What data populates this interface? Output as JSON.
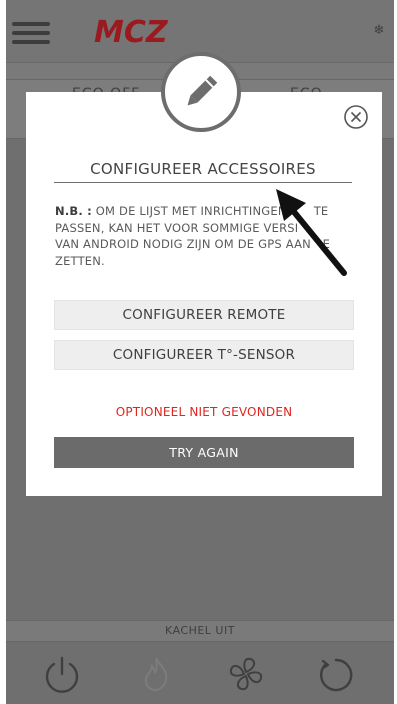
{
  "header": {
    "menu_icon": "hamburger-icon",
    "logo_text": "MCZ",
    "logo_color": "#c8161d",
    "right_icon": "snowflake-icon"
  },
  "modes": {
    "left": "ECO OFF",
    "right": "ECO"
  },
  "status": {
    "text": "KACHEL UIT"
  },
  "bottom_bar": {
    "icons": [
      "power-icon",
      "flame-icon",
      "fan-icon",
      "refresh-icon"
    ]
  },
  "modal": {
    "badge_icon": "pencil-icon",
    "close_icon": "close-circle-icon",
    "title": "CONFIGUREER ACCESSOIRES",
    "note_label": "N.B. :",
    "note_text": "OM DE LIJST MET INRICHTINGEN ... TE PASSEN, KAN HET VOOR SOMMIGE VERSI... VAN ANDROID NODIG ZIJN OM DE GPS AAN ... ZETTEN.",
    "note_line1": " OM DE LIJST MET INRICHTINGEN",
    "note_line1b": "TE",
    "note_line2": "PASSEN, KAN HET VOOR SOMMIGE VERSI",
    "note_line3": "VAN ANDROID NODIG ZIJN OM DE GPS AAN",
    "note_line3b": "E",
    "note_line4": "ZETTEN.",
    "buttons": {
      "remote": "CONFIGUREER REMOTE",
      "sensor": "CONFIGUREER T°-SENSOR"
    },
    "not_found": "OPTIONEEL NIET GEVONDEN",
    "try_again": "TRY AGAIN"
  },
  "colors": {
    "accent_red": "#e1251b",
    "dim_overlay": "#6f6f6f",
    "button_dark": "#6b6b6b"
  }
}
